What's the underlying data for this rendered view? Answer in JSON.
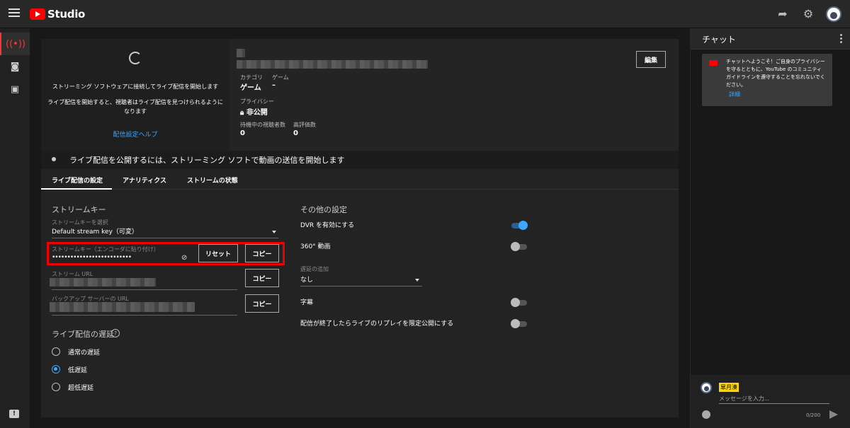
{
  "topbar": {
    "logo_text": "Studio"
  },
  "preview": {
    "line1": "ストリーミング ソフトウェアに接続してライブ配信を開始します",
    "line2": "ライブ配信を開始すると、視聴者はライブ配信を見つけられるように",
    "line3": "なります",
    "help_link": "配信設定ヘルプ"
  },
  "info": {
    "edit_label": "編集",
    "category_label": "カテゴリ",
    "category_value": "ゲーム",
    "game_label": "ゲーム",
    "game_value": "–",
    "privacy_label": "プライバシー",
    "privacy_value": "非公開",
    "waiting_label": "待機中の視聴者数",
    "waiting_value": "0",
    "likes_label": "高評価数",
    "likes_value": "0"
  },
  "notice": {
    "text": "ライブ配信を公開するには、ストリーミング ソフトで動画の送信を開始します"
  },
  "tabs": [
    {
      "label": "ライブ配信の設定"
    },
    {
      "label": "アナリティクス"
    },
    {
      "label": "ストリームの状態"
    }
  ],
  "stream": {
    "section_title": "ストリームキー",
    "select_label": "ストリームキーを選択",
    "select_value": "Default stream key（可変）",
    "key_label": "ストリームキー（エンコーダに貼り付け）",
    "key_value": "••••••••••••••••••••••••••",
    "reset_label": "リセット",
    "copy_label": "コピー",
    "url_label": "ストリーム URL",
    "backup_label": "バックアップ サーバーの URL",
    "latency_title": "ライブ配信の遅延",
    "help_icon": "?",
    "latency_options": [
      {
        "label": "通常の遅延",
        "selected": false
      },
      {
        "label": "低遅延",
        "selected": true
      },
      {
        "label": "超低遅延",
        "selected": false
      }
    ]
  },
  "other": {
    "section_title": "その他の設定",
    "dvr_label": "DVR を有効にする",
    "dvr_on": true,
    "video360_label": "360° 動画",
    "video360_on": false,
    "delay_label": "遅延の追加",
    "delay_value": "なし",
    "captions_label": "字幕",
    "captions_on": false,
    "replay_label": "配信が終了したらライブのリプレイを限定公開にする",
    "replay_on": false
  },
  "chat": {
    "title": "チャット",
    "welcome_text": "チャットへようこそ！ご自身のプライバシーを守るとともに、YouTube のコミュニティ ガイドラインを遵守することを忘れないでください。",
    "welcome_link": "詳細",
    "username": "皐月湊",
    "placeholder": "メッセージを入力...",
    "counter": "0/200"
  },
  "colors": {
    "accent": "#3ea6ff",
    "highlight": "#e00000",
    "brand": "#ff0000"
  }
}
